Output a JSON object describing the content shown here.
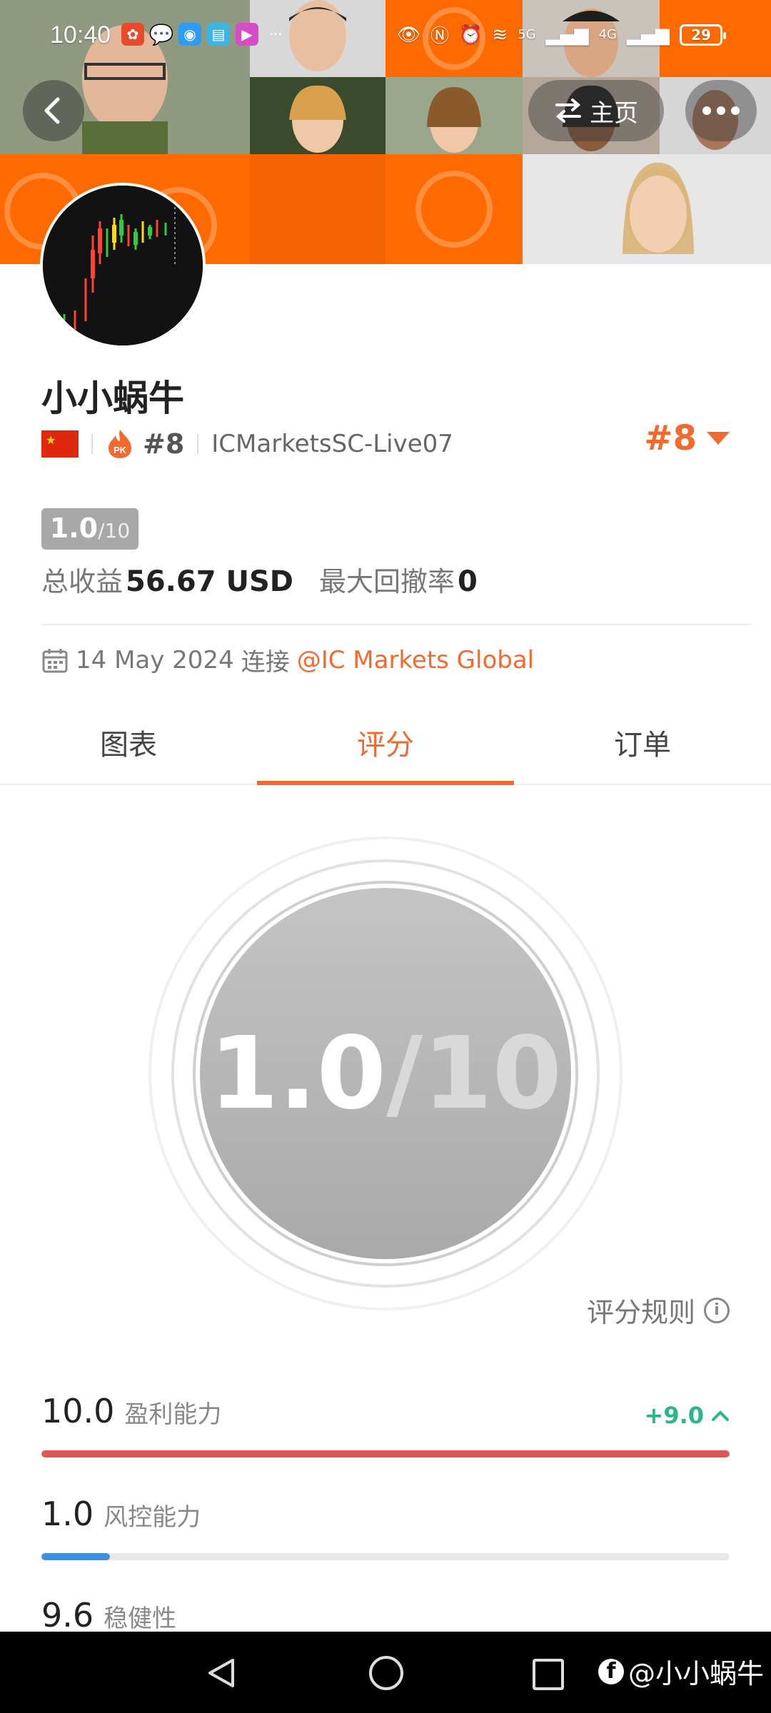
{
  "status_bar": {
    "time": "10:40",
    "network_1": "5G",
    "network_2": "4G",
    "battery": "29"
  },
  "header": {
    "home_label": "主页"
  },
  "profile": {
    "username": "小小蜗牛",
    "pk_rank": "#8",
    "server": "ICMarketsSC-Live07",
    "rank": "#8",
    "score_main": "1.0",
    "score_total": "/10",
    "total_earn_label": "总收益",
    "total_earn_value": "56.67 USD",
    "max_drawdown_label": "最大回撤率",
    "max_drawdown_value": "0",
    "date": "14 May 2024",
    "connect_label": "连接",
    "broker": "@IC Markets Global"
  },
  "tabs": [
    {
      "label": "图表"
    },
    {
      "label": "评分"
    },
    {
      "label": "订单"
    }
  ],
  "score_circle": {
    "main": "1.0",
    "total": "/10"
  },
  "rule_link": "评分规则",
  "metrics": [
    {
      "value": "10.0",
      "name": "盈利能力",
      "delta": "+9.0",
      "fill": 1.0,
      "color": "#e05555"
    },
    {
      "value": "1.0",
      "name": "风控能力",
      "delta": "",
      "fill": 0.1,
      "color": "#3d8fe0"
    },
    {
      "value": "9.6",
      "name": "稳健性",
      "delta": "",
      "fill": 0.96,
      "color": "#e05555"
    }
  ],
  "watermark": "@小小蜗牛",
  "colors": {
    "accent": "#f26a2d",
    "header_orange": "#ff6a00",
    "positive": "#2bb58b"
  }
}
